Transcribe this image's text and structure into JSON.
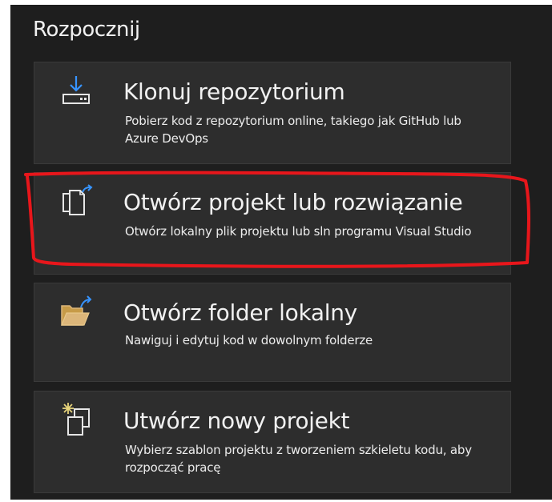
{
  "section": {
    "title": "Rozpocznij"
  },
  "cards": [
    {
      "title": "Klonuj repozytorium",
      "description": "Pobierz kod z repozytorium online, takiego jak GitHub lub Azure DevOps",
      "icon": "clone-repository-icon"
    },
    {
      "title": "Otwórz projekt lub rozwiązanie",
      "description": "Otwórz lokalny plik projektu lub sln programu Visual Studio",
      "icon": "open-project-icon"
    },
    {
      "title": "Otwórz folder lokalny",
      "description": "Nawiguj i edytuj kod w dowolnym folderze",
      "icon": "open-folder-icon"
    },
    {
      "title": "Utwórz nowy projekt",
      "description": "Wybierz szablon projektu z tworzeniem szkieletu kodu, aby rozpocząć pracę",
      "icon": "new-project-icon"
    }
  ],
  "colors": {
    "background": "#1e1e1e",
    "card": "#2d2d2d",
    "text": "#f1f1f1",
    "icon_accent": "#3794ff",
    "folder": "#dcb67a",
    "highlight_annotation": "#e8161b"
  }
}
